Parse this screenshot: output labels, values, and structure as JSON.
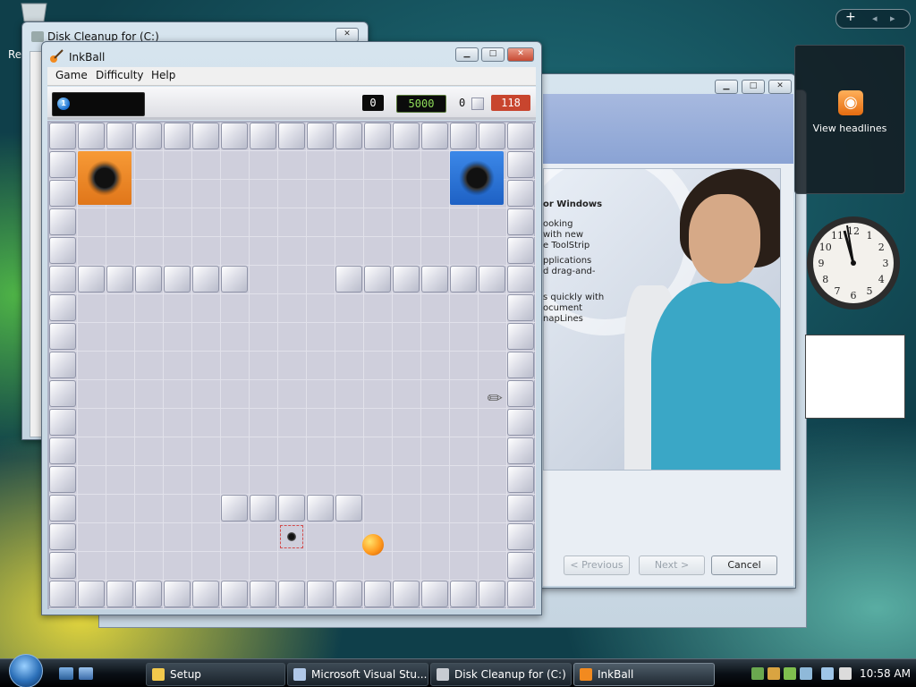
{
  "desktop": {
    "recycle_bin_label": "Re"
  },
  "disk_cleanup_window": {
    "title": "Disk Cleanup for  (C:)"
  },
  "vs_window": {
    "text_lines": [
      "or Windows",
      "ooking",
      "with new",
      "e ToolStrip",
      "pplications",
      "d drag-and-",
      "s quickly with",
      "ocument",
      "napLines"
    ],
    "buttons": {
      "previous": "< Previous",
      "next": "Next >",
      "cancel": "Cancel"
    }
  },
  "gadgets": {
    "feed_label": "View headlines",
    "clock_numbers": [
      "12",
      "1",
      "2",
      "3",
      "4",
      "5",
      "6",
      "7",
      "8",
      "9",
      "10",
      "11"
    ]
  },
  "inkball": {
    "title": "InkBall",
    "menu": [
      "Game",
      "Difficulty",
      "Help"
    ],
    "status": {
      "next_ball_number": "1",
      "score_left": "0",
      "score_main": "5000",
      "balls_count": "0",
      "timer": "118"
    },
    "colors": {
      "timer_bg": "#c8452e",
      "score_main_color": "#8fdc5a",
      "hole_orange": "#f08a2a",
      "hole_blue": "#2a72d8"
    }
  },
  "taskbar": {
    "tasks": [
      "Setup",
      "Microsoft Visual Stu...",
      "Disk Cleanup for  (C:)",
      "InkBall"
    ],
    "active_task": "InkBall",
    "time": "10:58 AM"
  },
  "sidebar_control": {
    "add": "+",
    "prev": "◂",
    "next": "▸"
  }
}
